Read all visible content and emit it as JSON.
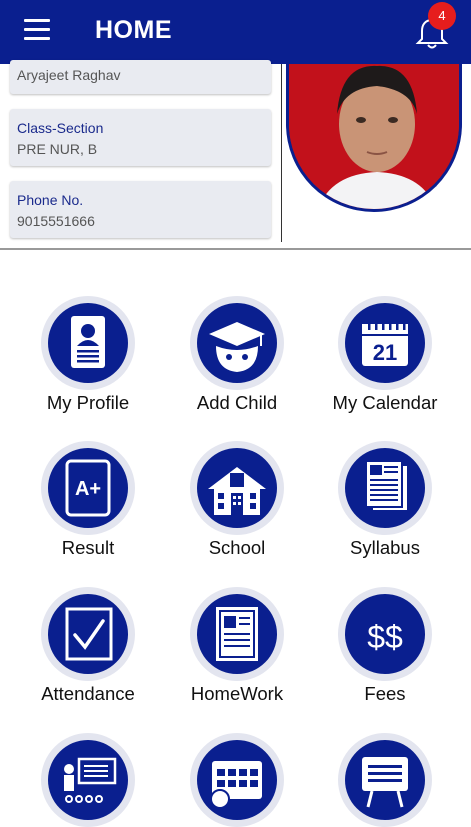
{
  "header": {
    "title": "HOME",
    "notification_count": "4"
  },
  "profile": {
    "name": "Aryajeet Raghav",
    "class_label": "Class-Section",
    "class_value": "PRE NUR, B",
    "phone_label": "Phone No.",
    "phone_value": "9015551666"
  },
  "menu": [
    {
      "label": "My Profile",
      "icon": "profile-icon"
    },
    {
      "label": "Add Child",
      "icon": "add-child-icon"
    },
    {
      "label": "My Calendar",
      "icon": "calendar-icon"
    },
    {
      "label": "Result",
      "icon": "result-icon"
    },
    {
      "label": "School",
      "icon": "school-icon"
    },
    {
      "label": "Syllabus",
      "icon": "syllabus-icon"
    },
    {
      "label": "Attendance",
      "icon": "attendance-icon"
    },
    {
      "label": "HomeWork",
      "icon": "homework-icon"
    },
    {
      "label": "Fees",
      "icon": "fees-icon"
    },
    {
      "label": "",
      "icon": "teacher-icon"
    },
    {
      "label": "",
      "icon": "timetable-icon"
    },
    {
      "label": "",
      "icon": "notice-board-icon"
    }
  ],
  "colors": {
    "primary": "#0a1f8f",
    "badge": "#e61d1d",
    "circle_ring": "#e3e5ef",
    "card_bg": "#e9ebf1"
  },
  "calendar_day": "21",
  "result_grade": "A+",
  "fees_symbol": "$$"
}
